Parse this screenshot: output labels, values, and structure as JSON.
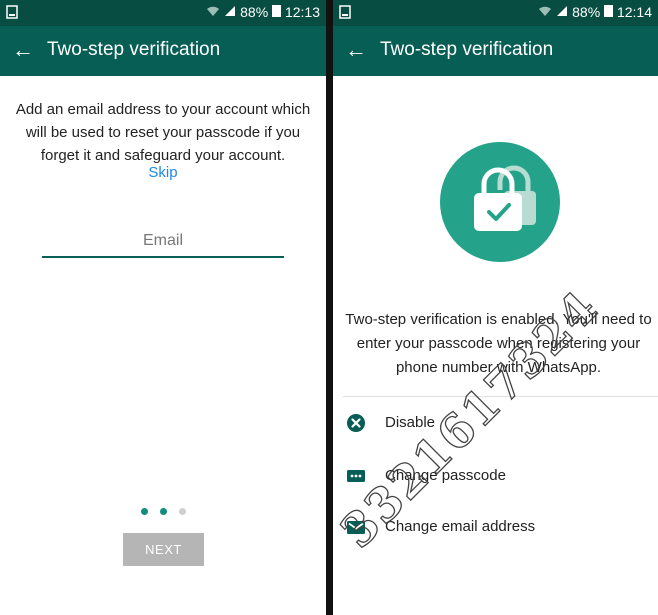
{
  "status_bar": {
    "left": {
      "icon": "notification-icon",
      "battery": "88%",
      "time": "12:13"
    },
    "right": {
      "icon": "notification-icon",
      "battery": "88%",
      "time": "12:14"
    }
  },
  "app_bar": {
    "back_label": "←",
    "title": "Two-step verification"
  },
  "email_screen": {
    "intro_text": "Add an email address to your account which will be used to reset your passcode if you forget it and safeguard your account.",
    "skip_label": "Skip",
    "email": {
      "value": "",
      "placeholder": "Email"
    },
    "page_indicator": {
      "count": 3,
      "current": 2
    },
    "next_label": "NEXT"
  },
  "enabled_screen": {
    "hero_icon": "lock-check-icon",
    "message": "Two-step verification is enabled. You'll need to enter your passcode when registering your phone number with WhatsApp.",
    "options": [
      {
        "label": "Disable",
        "icon": "disable-x-icon"
      },
      {
        "label": "Change passcode",
        "icon": "passcode-icon"
      },
      {
        "label": "Change email address",
        "icon": "email-icon"
      }
    ]
  },
  "watermark": {
    "text": "3321617324"
  },
  "colors": {
    "app_bar": "#075e54",
    "status_bar": "#074d41",
    "accent": "#25a38a",
    "link": "#1e88e5",
    "button_disabled": "#b5b5b5"
  }
}
